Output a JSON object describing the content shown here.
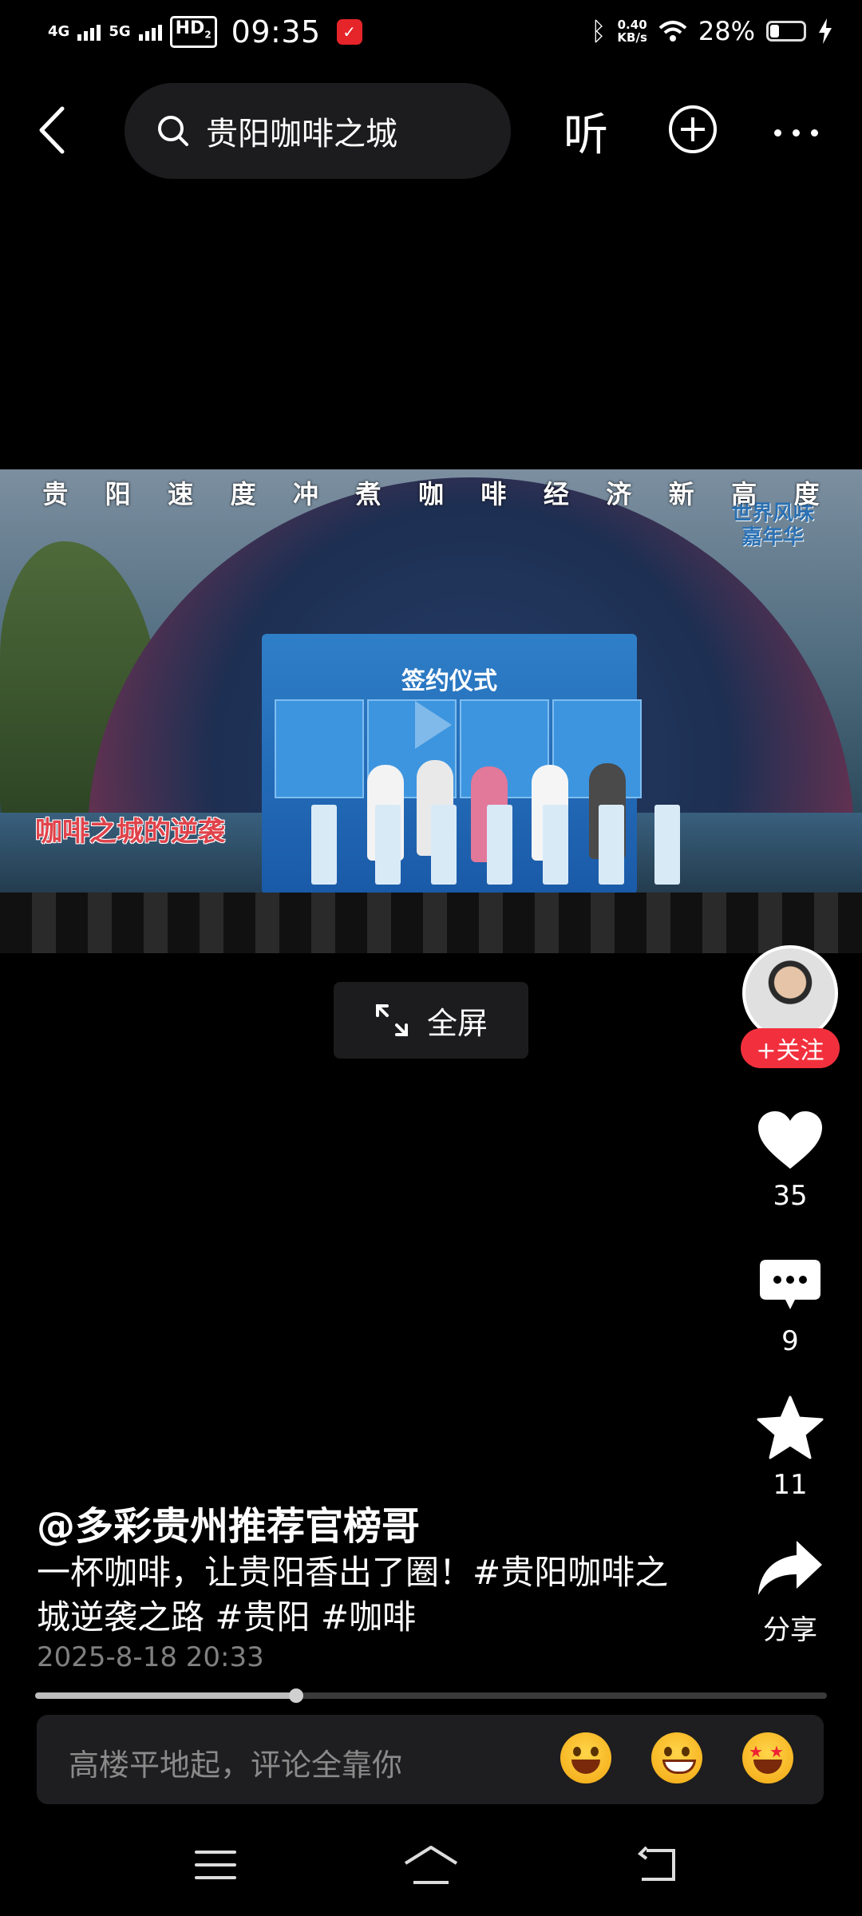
{
  "status_bar": {
    "net1": "4G",
    "net2": "5G",
    "hd": "HD",
    "hd_sub": "2",
    "time": "09:35",
    "speed_value": "0.40",
    "speed_unit": "KB/s",
    "battery_pct": "28%",
    "battery_level": 0.28,
    "icons": [
      "bluetooth-icon",
      "wifi-icon",
      "battery-icon",
      "charging-icon"
    ]
  },
  "top_bar": {
    "search_text": "贵阳咖啡之城",
    "listen_label": "听",
    "icons": [
      "back-icon",
      "search-icon",
      "add-icon",
      "more-icon"
    ]
  },
  "video": {
    "headline_chars": [
      "贵",
      "阳",
      "速",
      "度",
      "冲",
      "煮",
      "咖",
      "啡",
      "经",
      "济",
      "新",
      "高",
      "度"
    ],
    "subtitle": "咖啡之城的逆袭",
    "screen_title": "签约仪式",
    "brand_line1": "世界风味",
    "brand_line2": "嘉年华"
  },
  "fullscreen_label": "全屏",
  "rail": {
    "follow_label": "+关注",
    "like_count": "35",
    "comment_count": "9",
    "favorite_count": "11",
    "share_label": "分享"
  },
  "post": {
    "author": "@多彩贵州推荐官榜哥",
    "description": "一杯咖啡，让贵阳香出了圈！#贵阳咖啡之城逆袭之路 #贵阳 #咖啡",
    "date": "2025-8-18 20:33"
  },
  "progress": 0.33,
  "comment_bar": {
    "placeholder": "高楼平地起，评论全靠你",
    "emojis": [
      "laughing-emoji",
      "grinning-emoji",
      "star-eyes-emoji"
    ]
  },
  "accent_color": "#f2303d"
}
